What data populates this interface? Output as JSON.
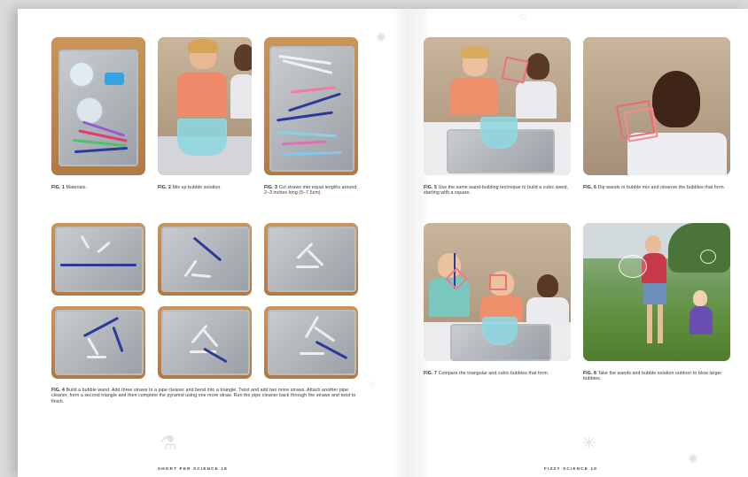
{
  "left_page": {
    "figures": [
      {
        "label": "FIG. 1",
        "text": "Materials."
      },
      {
        "label": "FIG. 2",
        "text": "Mix up bubble solution."
      },
      {
        "label": "FIG. 3",
        "text": "Cut straws into equal lengths around 2–3 inches long (5–7.5cm)."
      },
      {
        "label": "FIG. 4",
        "text": "Build a bubble wand. Add three straws to a pipe cleaner and bend into a triangle. Twist and add two more straws. Attach another pipe cleaner, form a second triangle and then complete the pyramid using one more straw. Run the pipe cleaner back through the straws and twist to finish."
      }
    ],
    "footer": "SHORT PER SCIENCE  18"
  },
  "right_page": {
    "figures": [
      {
        "label": "FIG. 5",
        "text": "Use the same wand-building technique to build a cubic wand, starting with a square."
      },
      {
        "label": "FIG. 6",
        "text": "Dip wands in bubble mix and observe the bubbles that form."
      },
      {
        "label": "FIG. 7",
        "text": "Compare the triangular and cubic bubbles that form."
      },
      {
        "label": "FIG. 8",
        "text": "Take the wands and bubble solution outdoor to blow larger bubbles."
      }
    ],
    "footer": "FIZZY SCIENCE  19"
  },
  "icons": [
    "atom-icon",
    "flask-icon",
    "star-icon",
    "snowflake-icon"
  ],
  "colors": {
    "page": "#ffffff",
    "background": "#d9dadc",
    "pipe_cleaner": "#2a3a9a",
    "bubble_solution": "#8cd7e1"
  }
}
